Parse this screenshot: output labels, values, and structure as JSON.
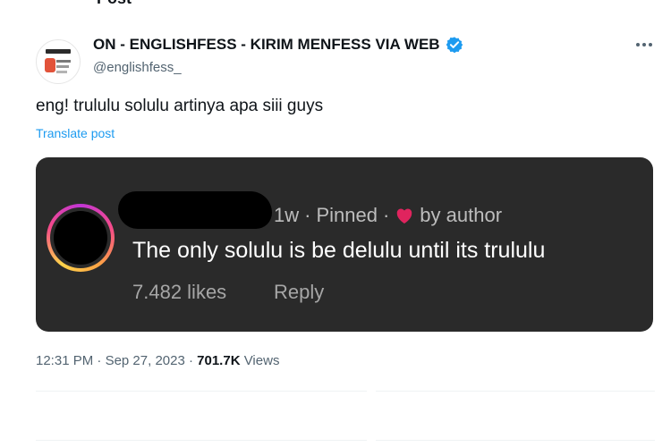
{
  "header_fragment": "Post",
  "post": {
    "display_name": "ON - ENGLISHFESS - KIRIM MENFESS VIA WEB",
    "handle": "@englishfess_",
    "text": "eng! trululu solulu artinya apa siii guys",
    "translate_label": "Translate post",
    "icons": {
      "verified": "verified-badge-icon",
      "more": "more-options-icon"
    },
    "accent_color": "#1d9bf0"
  },
  "embedded_comment": {
    "meta_time": "1w",
    "meta_pinned": "Pinned",
    "meta_by": "by author",
    "text": "The only solulu is be delulu until its trululu",
    "likes": "7.482 likes",
    "reply_label": "Reply",
    "heart_color": "#e0245e",
    "background": "#2a2a2a"
  },
  "footer": {
    "time": "12:31 PM",
    "date": "Sep 27, 2023",
    "views_count": "701.7K",
    "views_label": "Views"
  }
}
